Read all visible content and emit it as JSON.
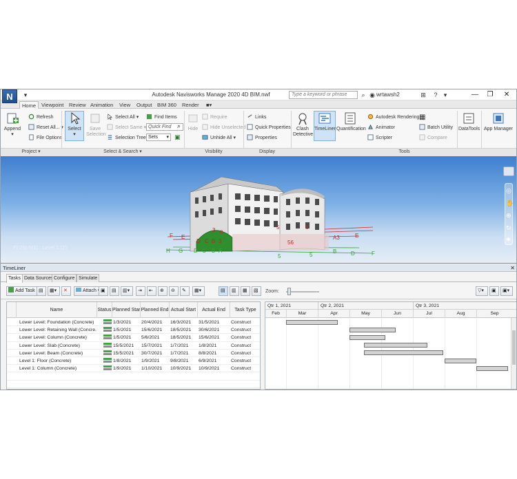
{
  "window": {
    "title": "Autodesk Navisworks Manage 2020    4D BIM.nwf",
    "search_placeholder": "Type a keyword or phrase",
    "user": "wrtawsh2",
    "app_logo": "N"
  },
  "ribbon_tabs": [
    "Home",
    "Viewpoint",
    "Review",
    "Animation",
    "View",
    "Output",
    "BIM 360",
    "Render",
    "■▾"
  ],
  "ribbon": {
    "project": {
      "append": "Append",
      "refresh": "Refresh",
      "reset_all": "Reset All...",
      "file_options": "File Options",
      "label": "Project ▾"
    },
    "select_search": {
      "select": "Select",
      "save_selection": "Save Selection",
      "select_all": "Select All",
      "select_same": "Select Same",
      "selection_tree": "Selection Tree",
      "find_items": "Find Items",
      "quick_find_placeholder": "Quick Find",
      "sets": "Sets",
      "label": "Select & Search ▾"
    },
    "visibility": {
      "hide": "Hide",
      "require": "Require",
      "hide_unselected": "Hide Unselected",
      "unhide_all": "Unhide All",
      "label": "Visibility"
    },
    "display": {
      "links": "Links",
      "quick_properties": "Quick Properties",
      "properties": "Properties",
      "label": "Display"
    },
    "tools": {
      "clash_detective": "Clash Detective",
      "timeliner": "TimeLiner",
      "quantification": "Quantification",
      "autodesk_rendering": "Autodesk Rendering",
      "animator": "Animator",
      "scripter": "Scripter",
      "batch_utility": "Batch Utility",
      "compare": "Compare",
      "datatools": "DataTools",
      "app_manager": "App Manager",
      "label": "Tools"
    }
  },
  "viewport": {
    "grid_info": "F(-29)-5(1) : Level 1 (2)"
  },
  "timeliner": {
    "title": "TimeLiner",
    "tabs": [
      "Tasks",
      "Data Sources",
      "Configure",
      "Simulate"
    ],
    "toolbar": {
      "add_task": "Add Task",
      "attach": "Attach",
      "zoom": "Zoom:"
    },
    "columns": [
      "Name",
      "Status",
      "Planned Start",
      "Planned End",
      "Actual Start",
      "Actual End",
      "Task Type"
    ],
    "rows": [
      [
        "Lower Level: Foundation (Concrete)",
        "1/3/2021",
        "20/4/2021",
        "16/3/2021",
        "31/5/2021",
        "Construct"
      ],
      [
        "Lower Level: Retaining Wall (Concre...",
        "1/5/2021",
        "15/6/2021",
        "18/5/2021",
        "30/6/2021",
        "Construct"
      ],
      [
        "Lower Level: Column (Concrete)",
        "1/5/2021",
        "5/6/2021",
        "18/5/2021",
        "15/6/2021",
        "Construct"
      ],
      [
        "Lower Level: Slab (Concrete)",
        "15/5/2021",
        "15/7/2021",
        "1/7/2021",
        "1/8/2021",
        "Construct"
      ],
      [
        "Lower Level: Beam (Concrete)",
        "15/5/2021",
        "30/7/2021",
        "1/7/2021",
        "8/8/2021",
        "Construct"
      ],
      [
        "Level 1: Floor (Concrete)",
        "1/8/2021",
        "1/9/2021",
        "9/8/2021",
        "6/9/2021",
        "Construct"
      ],
      [
        "Level 1: Column (Concrete)",
        "1/9/2021",
        "1/10/2021",
        "10/9/2021",
        "10/9/2021",
        "Construct"
      ],
      [
        "",
        "",
        "",
        "",
        "",
        ""
      ],
      [
        "",
        "",
        "",
        "",
        "",
        ""
      ]
    ],
    "gantt": {
      "quarters": [
        "Qtr 1, 2021",
        "Qtr 2, 2021",
        "Qtr 3, 2021"
      ],
      "months": [
        "Feb",
        "Mar",
        "Apr",
        "May",
        "Jun",
        "Jul",
        "Aug",
        "Sep"
      ]
    }
  }
}
